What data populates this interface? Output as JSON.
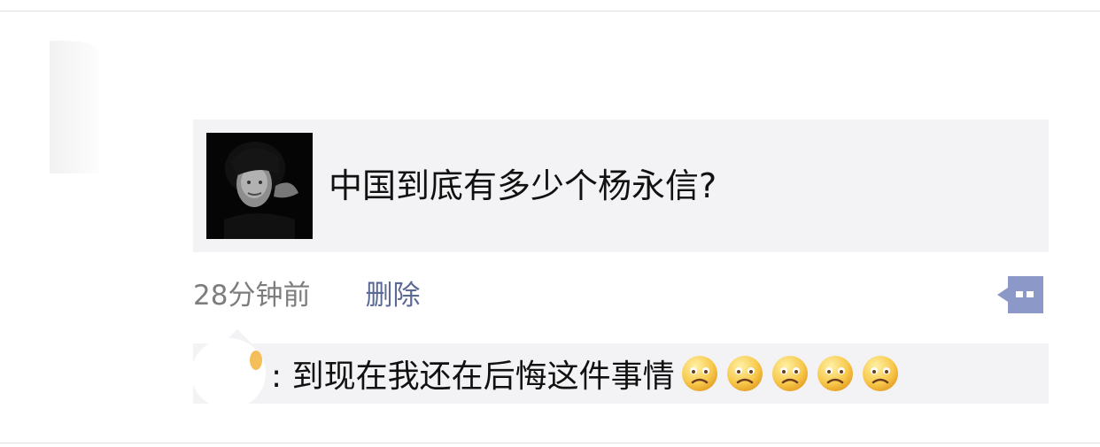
{
  "moment": {
    "shared_item": {
      "title": "中国到底有多少个杨永信?"
    },
    "meta": {
      "timestamp": "28分钟前",
      "delete_label": "删除"
    },
    "comment": {
      "text": ": 到现在我还在后悔这件事情",
      "emojis": [
        "frown-emoji",
        "frown-emoji",
        "frown-emoji",
        "frown-emoji",
        "frown-emoji"
      ]
    },
    "icons": {
      "comment_button": "comment-more-icon"
    },
    "colors": {
      "card_background": "#f3f3f5",
      "link_color": "#5a6a95",
      "timestamp_color": "#7d7d7d",
      "comment_button_color": "#8b98c8"
    }
  }
}
